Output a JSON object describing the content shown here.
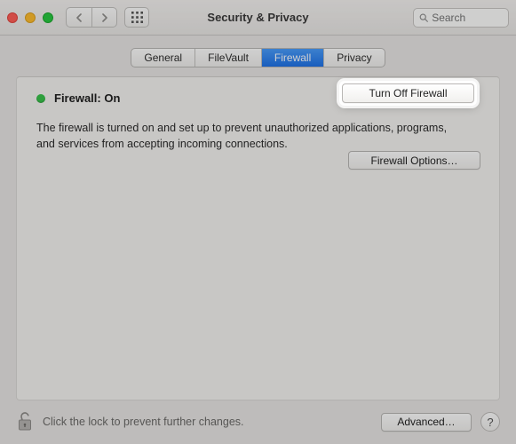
{
  "window": {
    "title": "Security & Privacy"
  },
  "search": {
    "placeholder": "Search",
    "value": ""
  },
  "tabs": [
    {
      "label": "General"
    },
    {
      "label": "FileVault"
    },
    {
      "label": "Firewall",
      "active": true
    },
    {
      "label": "Privacy"
    }
  ],
  "firewall": {
    "status_label": "Firewall: On",
    "status_color": "#39c24b",
    "turn_off_label": "Turn Off Firewall",
    "description": "The firewall is turned on and set up to prevent unauthorized applications, programs, and services from accepting incoming connections.",
    "options_label": "Firewall Options…"
  },
  "footer": {
    "lock_text": "Click the lock to prevent further changes.",
    "advanced_label": "Advanced…",
    "help_label": "?"
  }
}
